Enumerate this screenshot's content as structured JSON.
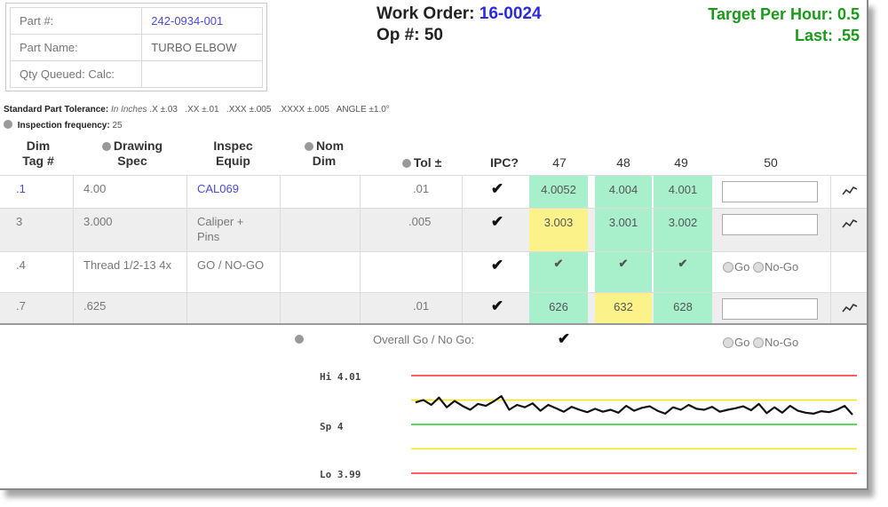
{
  "part": {
    "part_no_label": "Part #:",
    "part_no": "242-0934-001",
    "part_name_label": "Part Name:",
    "part_name": "TURBO ELBOW",
    "qty_label": "Qty Queued: Calc:"
  },
  "work_order": {
    "label": "Work Order:",
    "number": "16-0024",
    "op_label": "Op #:",
    "op": "50"
  },
  "target": {
    "per_hour": "Target Per Hour: 0.5",
    "last": "Last: .55"
  },
  "tolerance": {
    "label": "Standard Part Tolerance:",
    "units": "In Inches",
    "text": ".X ±.03   .XX ±.01   .XXX ±.005   .XXXX ±.005   ANGLE ±1.0°"
  },
  "frequency": {
    "label": "Inspection frequency:",
    "value": "25"
  },
  "headers": {
    "dim_tag": "Dim\nTag #",
    "drawing_spec": "Drawing\nSpec",
    "inspec_equip": "Inspec\nEquip",
    "nom_dim": "Nom\nDim",
    "tol": "Tol ±",
    "ipc": "IPC?",
    "samples": [
      "47",
      "48",
      "49",
      "50"
    ]
  },
  "rows": [
    {
      "tag": ".1",
      "spec": "4.00",
      "equip": "CAL069",
      "tol": ".01",
      "ipc": "✔",
      "m": [
        "4.0052",
        "4.004",
        "4.001"
      ]
    },
    {
      "tag": "3",
      "spec": "3.000",
      "equip": "Caliper + Pins",
      "tol": ".005",
      "ipc": "✔",
      "m": [
        "3.003",
        "3.001",
        "3.002"
      ]
    },
    {
      "tag": ".4",
      "spec": "Thread 1/2-13 4x",
      "equip": "GO / NO-GO",
      "tol": "",
      "ipc": "✔",
      "m": [
        "✔",
        "✔",
        "✔"
      ]
    },
    {
      "tag": ".7",
      "spec": ".625",
      "equip": "",
      "tol": ".01",
      "ipc": "✔",
      "m": [
        "626",
        "632",
        "628"
      ]
    }
  ],
  "go": "Go",
  "nogo": "No-Go",
  "overall": {
    "label": "Overall Go / No Go:",
    "check": "✔"
  },
  "trend_icon": "trend-line-icon",
  "chart_data": {
    "type": "line",
    "control_labels": {
      "hi": "Hi 4.01",
      "sp": "Sp 4",
      "lo": "Lo 3.99"
    },
    "ylim": [
      3.988,
      4.012
    ],
    "limits": {
      "hi": 4.01,
      "upper_warn": 4.005,
      "sp": 4.0,
      "lower_warn": 3.995,
      "lo": 3.99
    },
    "values": [
      4.0045,
      4.005,
      4.004,
      4.0055,
      4.0035,
      4.0048,
      4.0038,
      4.003,
      4.0042,
      4.0038,
      4.0047,
      4.0058,
      4.003,
      4.004,
      4.0035,
      4.0043,
      4.0028,
      4.004,
      4.0033,
      4.0026,
      4.0036,
      4.003,
      4.0025,
      4.0032,
      4.0026,
      4.003,
      4.0024,
      4.0038,
      4.0028,
      4.0034,
      4.0037,
      4.0028,
      4.0022,
      4.0035,
      4.003,
      4.004,
      4.0032,
      4.003,
      4.0036,
      4.0026,
      4.003,
      4.0033,
      4.0037,
      4.0029,
      4.0042,
      4.0023,
      4.0035,
      4.0024,
      4.0038,
      4.0028,
      4.0024,
      4.0022,
      4.0027,
      4.0025,
      4.003,
      4.0038,
      4.002
    ],
    "colors": {
      "line": "#111111",
      "hi_lo": "#ff2a2a",
      "warn": "#ffe600",
      "sp": "#22cc22"
    }
  }
}
